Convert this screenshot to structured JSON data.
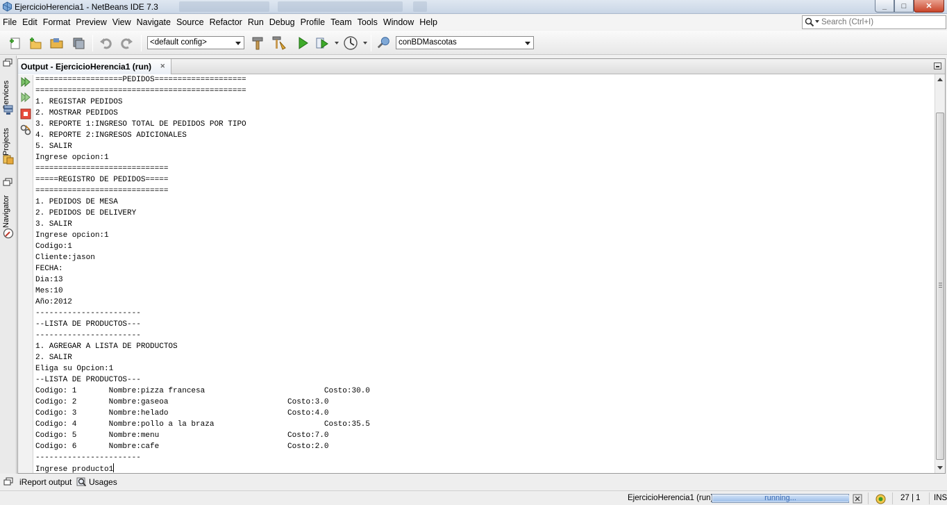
{
  "window": {
    "title": "EjercicioHerencia1 - NetBeans IDE 7.3",
    "buttons": {
      "minimize": "_",
      "maximize": "□",
      "close": "✕"
    }
  },
  "menu": [
    "File",
    "Edit",
    "Format",
    "Preview",
    "View",
    "Navigate",
    "Source",
    "Refactor",
    "Run",
    "Debug",
    "Profile",
    "Team",
    "Tools",
    "Window",
    "Help"
  ],
  "search": {
    "placeholder": "Search (Ctrl+I)"
  },
  "toolbar": {
    "config_combo": "<default config>",
    "project_combo": "conBDMascotas"
  },
  "sidebar": {
    "tabs": [
      "Services",
      "Projects",
      "Navigator"
    ]
  },
  "output": {
    "tab_title": "Output - EjercicioHerencia1 (run)",
    "tab_close": "✕",
    "lines": [
      "===================PEDIDOS====================",
      "==============================================",
      "1. REGISTAR PEDIDOS",
      "2. MOSTRAR PEDIDOS",
      "3. REPORTE 1:INGRESO TOTAL DE PEDIDOS POR TIPO",
      "4. REPORTE 2:INGRESOS ADICIONALES",
      "5. SALIR",
      "Ingrese opcion:1",
      "=============================",
      "=====REGISTRO DE PEDIDOS=====",
      "=============================",
      "1. PEDIDOS DE MESA",
      "2. PEDIDOS DE DELIVERY",
      "3. SALIR",
      "Ingrese opcion:1",
      "Codigo:1",
      "Cliente:jason",
      "FECHA:",
      "Dia:13",
      "Mes:10",
      "Año:2012",
      "-----------------------",
      "--LISTA DE PRODUCTOS---",
      "-----------------------",
      "1. AGREGAR A LISTA DE PRODUCTOS",
      "2. SALIR",
      "Eliga su Opcion:1",
      "--LISTA DE PRODUCTOS---",
      "Codigo: 1       Nombre:pizza francesa                          Costo:30.0",
      "Codigo: 2       Nombre:gaseoa                          Costo:3.0",
      "Codigo: 3       Nombre:helado                          Costo:4.0",
      "Codigo: 4       Nombre:pollo a la braza                        Costo:35.5",
      "Codigo: 5       Nombre:menu                            Costo:7.0",
      "Codigo: 6       Nombre:cafe                            Costo:2.0",
      "-----------------------",
      "Ingrese producto1"
    ]
  },
  "bottom_tabs": [
    "iReport output",
    "Usages"
  ],
  "status": {
    "running_project": "EjercicioHerencia1 (run)",
    "progress_text": "running...",
    "position": "27 | 1",
    "mode": "INS"
  }
}
